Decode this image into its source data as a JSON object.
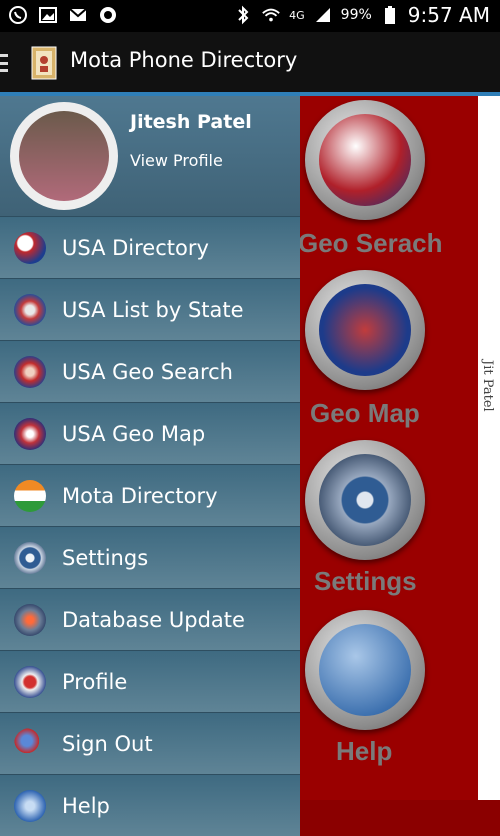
{
  "status_bar": {
    "battery": "99%",
    "time": "9:57 AM",
    "network": "4G"
  },
  "action_bar": {
    "title": "Mota Phone Directory"
  },
  "profile": {
    "name": "Jitesh Patel",
    "link_label": "View Profile"
  },
  "menu": {
    "items": [
      {
        "label": "USA Directory",
        "icon": "us-flag-icon"
      },
      {
        "label": "USA List by State",
        "icon": "us-seal-icon"
      },
      {
        "label": "USA Geo Search",
        "icon": "geo-search-icon"
      },
      {
        "label": "USA Geo Map",
        "icon": "geo-map-icon"
      },
      {
        "label": "Mota Directory",
        "icon": "india-flag-icon"
      },
      {
        "label": "Settings",
        "icon": "gear-icon"
      },
      {
        "label": "Database Update",
        "icon": "database-update-icon"
      },
      {
        "label": "Profile",
        "icon": "profile-icon"
      },
      {
        "label": "Sign Out",
        "icon": "sign-out-icon"
      },
      {
        "label": "Help",
        "icon": "help-icon"
      }
    ]
  },
  "background": {
    "labels": {
      "geo_search": "Geo Serach",
      "geo_map": "Geo Map",
      "settings": "Settings",
      "help": "Help"
    },
    "watermark": "Jit Patel"
  },
  "colors": {
    "drawer": "#5a7c8e",
    "background_red": "#9a0000",
    "accent_blue": "#2f7fb8"
  }
}
